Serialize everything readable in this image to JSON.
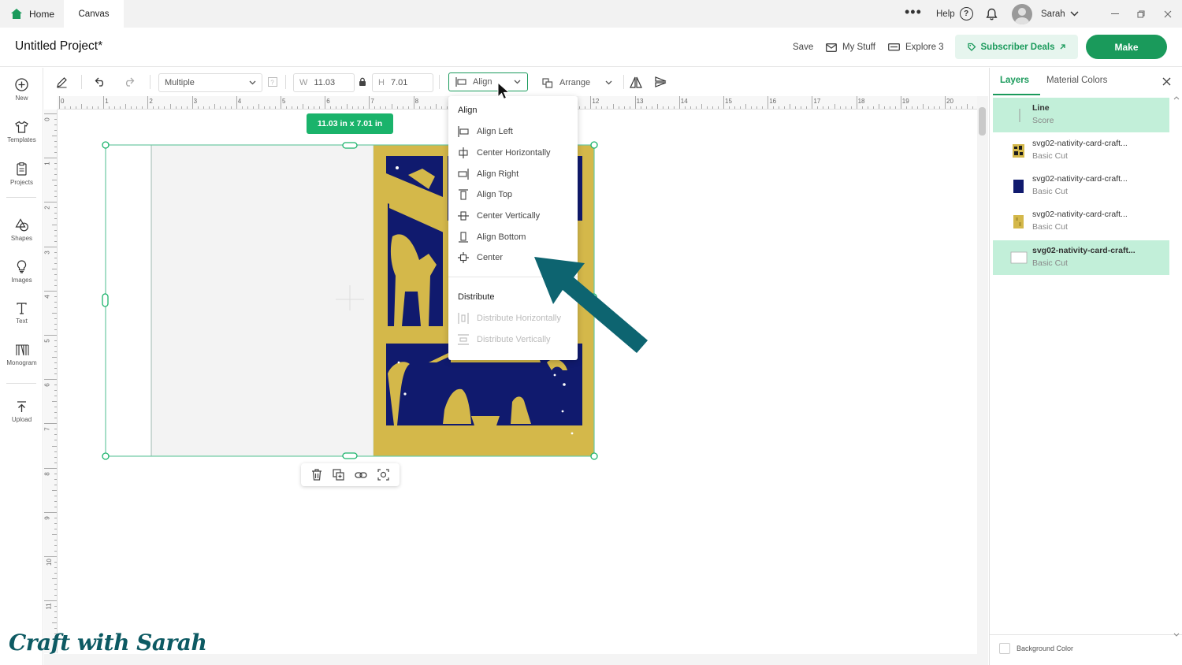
{
  "tabs": {
    "home": "Home",
    "canvas": "Canvas"
  },
  "topbar": {
    "more": "•••",
    "help": "Help",
    "help_glyph": "?",
    "user": "Sarah"
  },
  "header": {
    "project_title": "Untitled Project*",
    "save": "Save",
    "my_stuff": "My Stuff",
    "explore": "Explore 3",
    "subscriber_deals": "Subscriber Deals",
    "make": "Make"
  },
  "sidebar": {
    "items": [
      {
        "label": "New",
        "icon": "plus-circle-icon"
      },
      {
        "label": "Templates",
        "icon": "shirt-icon"
      },
      {
        "label": "Projects",
        "icon": "projects-icon"
      },
      {
        "label": "Shapes",
        "icon": "shapes-icon"
      },
      {
        "label": "Images",
        "icon": "lightbulb-icon"
      },
      {
        "label": "Text",
        "icon": "text-icon"
      },
      {
        "label": "Monogram",
        "icon": "monogram-icon"
      },
      {
        "label": "Upload",
        "icon": "upload-icon"
      }
    ]
  },
  "toolbar": {
    "operation": "Multiple",
    "width_label": "W",
    "width_value": "11.03",
    "height_label": "H",
    "height_value": "7.01",
    "align": "Align",
    "arrange": "Arrange"
  },
  "ruler": {
    "top": [
      "0",
      "1",
      "2",
      "3",
      "4",
      "5",
      "6",
      "7",
      "8",
      "9",
      "10",
      "11",
      "12",
      "13",
      "14",
      "15",
      "16",
      "17",
      "18",
      "19",
      "20"
    ],
    "left": [
      "0",
      "1",
      "2",
      "3",
      "4",
      "5",
      "6",
      "7",
      "8",
      "9",
      "10",
      "11"
    ]
  },
  "selection": {
    "dimensions": "11.03  in x 7.01  in"
  },
  "align_menu": {
    "align_heading": "Align",
    "items": [
      "Align Left",
      "Center Horizontally",
      "Align Right",
      "Align Top",
      "Center Vertically",
      "Align Bottom",
      "Center"
    ],
    "distribute_heading": "Distribute",
    "distribute_items": [
      "Distribute Horizontally",
      "Distribute Vertically"
    ]
  },
  "right_panel": {
    "tabs": {
      "layers": "Layers",
      "material_colors": "Material Colors"
    },
    "layers": [
      {
        "name": "Line",
        "operation": "Score",
        "selected": true,
        "thumb": "line"
      },
      {
        "name": "svg02-nativity-card-craft...",
        "operation": "Basic Cut",
        "selected": false,
        "thumb": "pattern"
      },
      {
        "name": "svg02-nativity-card-craft...",
        "operation": "Basic Cut",
        "selected": false,
        "thumb": "navy"
      },
      {
        "name": "svg02-nativity-card-craft...",
        "operation": "Basic Cut",
        "selected": false,
        "thumb": "gold"
      },
      {
        "name": "svg02-nativity-card-craft...",
        "operation": "Basic Cut",
        "selected": true,
        "thumb": "white"
      }
    ],
    "background_color": "Background Color"
  },
  "colors": {
    "accent": "#1a9a5b",
    "navy": "#101a6e",
    "gold": "#d4b84a",
    "arrow": "#0d6470"
  },
  "watermark": "Craft with Sarah"
}
